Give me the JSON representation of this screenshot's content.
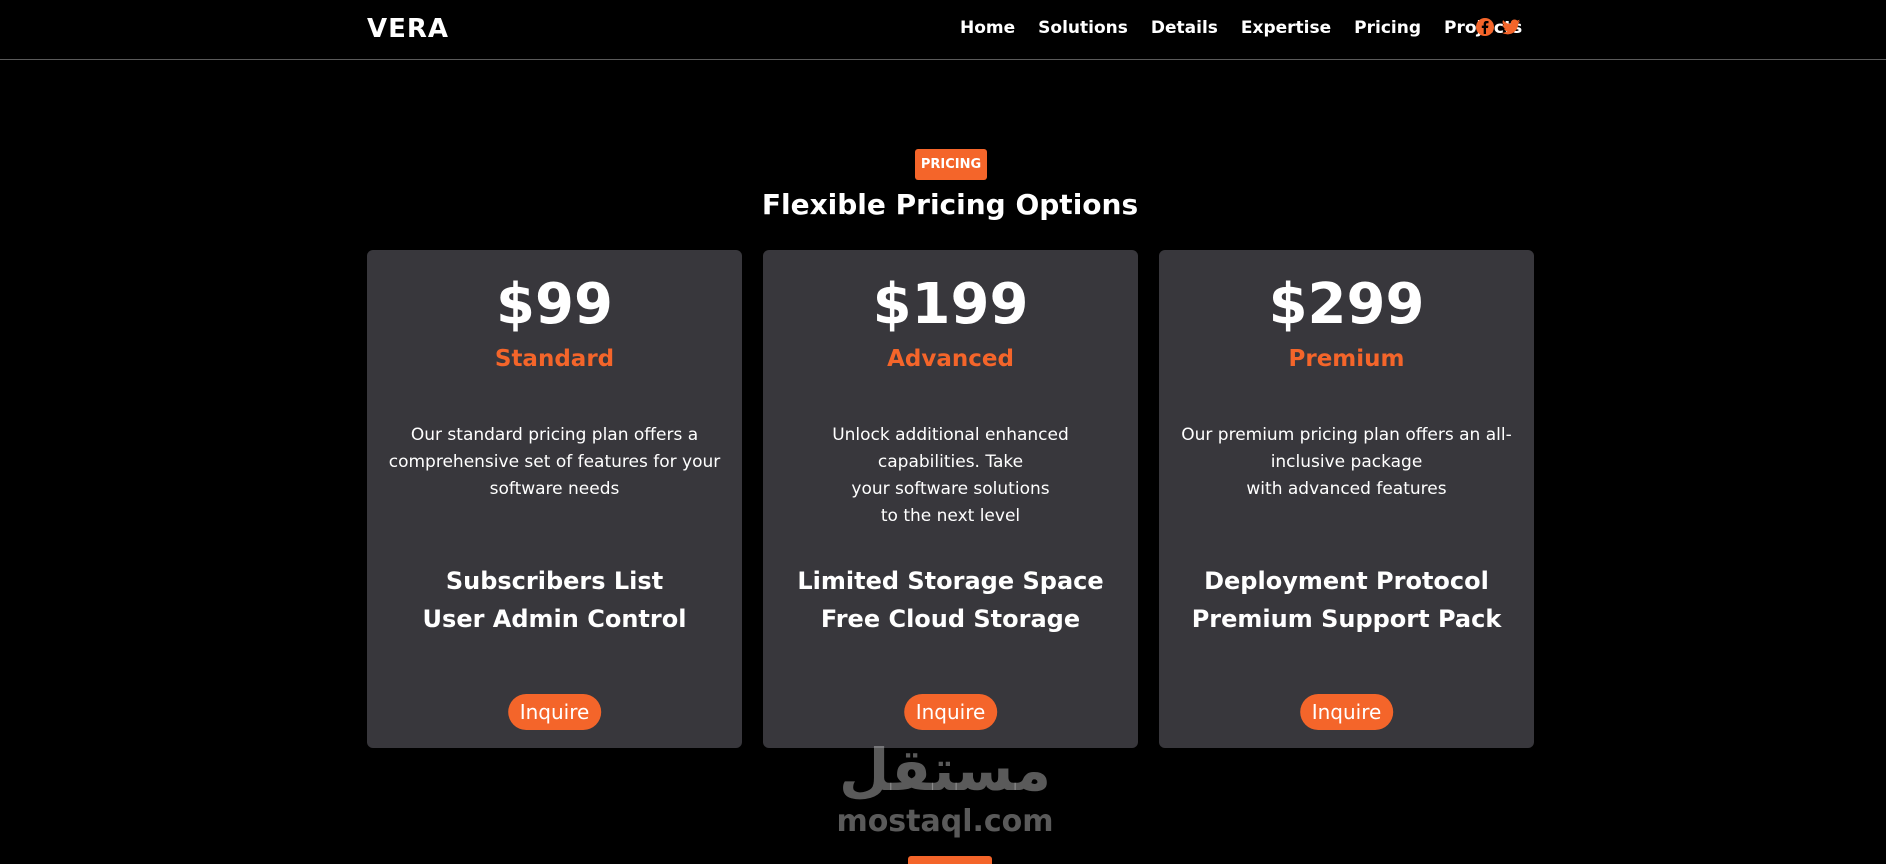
{
  "header": {
    "logo": "VERA",
    "nav": [
      "Home",
      "Solutions",
      "Details",
      "Expertise",
      "Pricing",
      "Projects"
    ],
    "social": [
      "facebook-icon",
      "twitter-icon"
    ],
    "accent_color": "#f4652a"
  },
  "pricing": {
    "badge": "PRICING",
    "title": "Flexible Pricing Options",
    "cards": [
      {
        "price": "$99",
        "plan": "Standard",
        "description": [
          "Our standard pricing plan offers a",
          "comprehensive set of features for your",
          "software needs"
        ],
        "features": [
          "Subscribers List",
          "User Admin Control"
        ],
        "button": "Inquire"
      },
      {
        "price": "$199",
        "plan": "Advanced",
        "description": [
          "Unlock additional enhanced capabilities. Take",
          "your software solutions",
          "to the next level"
        ],
        "features": [
          "Limited Storage Space",
          "Free Cloud Storage"
        ],
        "button": "Inquire"
      },
      {
        "price": "$299",
        "plan": "Premium",
        "description": [
          "Our premium pricing plan offers an all-",
          "inclusive package",
          "with advanced features"
        ],
        "features": [
          "Deployment Protocol",
          "Premium Support Pack"
        ],
        "button": "Inquire"
      }
    ]
  },
  "watermark": {
    "arabic": "مستقل",
    "latin": "mostaql.com"
  }
}
